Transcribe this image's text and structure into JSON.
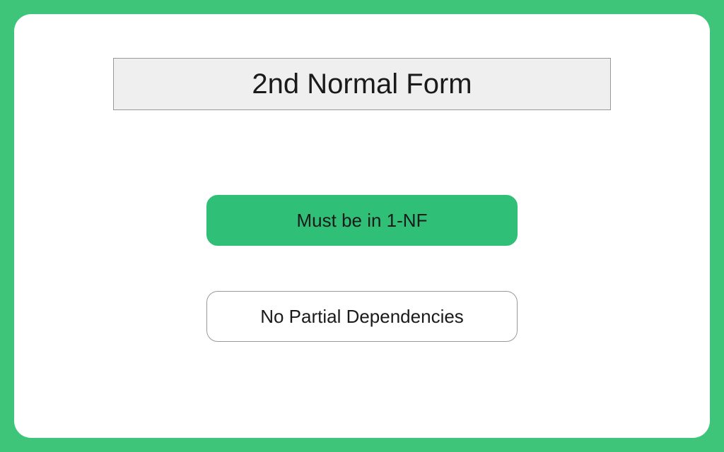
{
  "title": "2nd Normal Form",
  "rules": {
    "rule1": "Must be in 1-NF",
    "rule2": "No Partial Dependencies"
  },
  "colors": {
    "background": "#3ec57a",
    "card": "#ffffff",
    "titleBg": "#efefef",
    "highlight": "#2fbf77",
    "border": "#999999"
  }
}
